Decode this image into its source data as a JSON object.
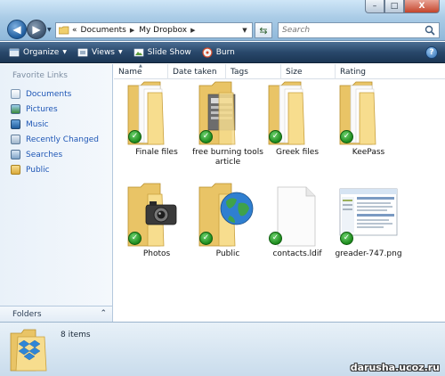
{
  "address": {
    "overflow": "«",
    "crumbs": [
      "Documents",
      "My Dropbox"
    ]
  },
  "search": {
    "placeholder": "Search"
  },
  "window": {
    "minimize": "–",
    "maximize": "□",
    "close": "X"
  },
  "toolbar": {
    "organize": "Organize",
    "views": "Views",
    "slideshow": "Slide Show",
    "burn": "Burn",
    "help": "?"
  },
  "sidebar": {
    "favorites_title": "Favorite Links",
    "items": [
      {
        "label": "Documents",
        "icon": "documents-icon"
      },
      {
        "label": "Pictures",
        "icon": "pictures-icon"
      },
      {
        "label": "Music",
        "icon": "music-icon"
      },
      {
        "label": "Recently Changed",
        "icon": "recently-changed-icon"
      },
      {
        "label": "Searches",
        "icon": "searches-icon"
      },
      {
        "label": "Public",
        "icon": "public-folder-icon"
      }
    ],
    "folders_label": "Folders"
  },
  "columns": [
    "Name",
    "Date taken",
    "Tags",
    "Size",
    "Rating"
  ],
  "files": [
    {
      "name": "Finale files",
      "type": "folder",
      "synced": true
    },
    {
      "name": "free burning tools article",
      "type": "folder-docs",
      "synced": true
    },
    {
      "name": "Greek files",
      "type": "folder",
      "synced": true
    },
    {
      "name": "KeePass",
      "type": "folder",
      "synced": true
    },
    {
      "name": "Photos",
      "type": "folder-camera",
      "synced": true
    },
    {
      "name": "Public",
      "type": "folder-globe",
      "synced": true
    },
    {
      "name": "contacts.ldif",
      "type": "file",
      "synced": true
    },
    {
      "name": "greader-747.png",
      "type": "image",
      "synced": true
    }
  ],
  "details": {
    "count": "8 items"
  },
  "watermark": "darusha.ucoz.ru",
  "colors": {
    "accent": "#1f57b6",
    "toolbar": "#29486b",
    "sync_check": "#1c8a1c",
    "folder": "#f2d27a"
  }
}
